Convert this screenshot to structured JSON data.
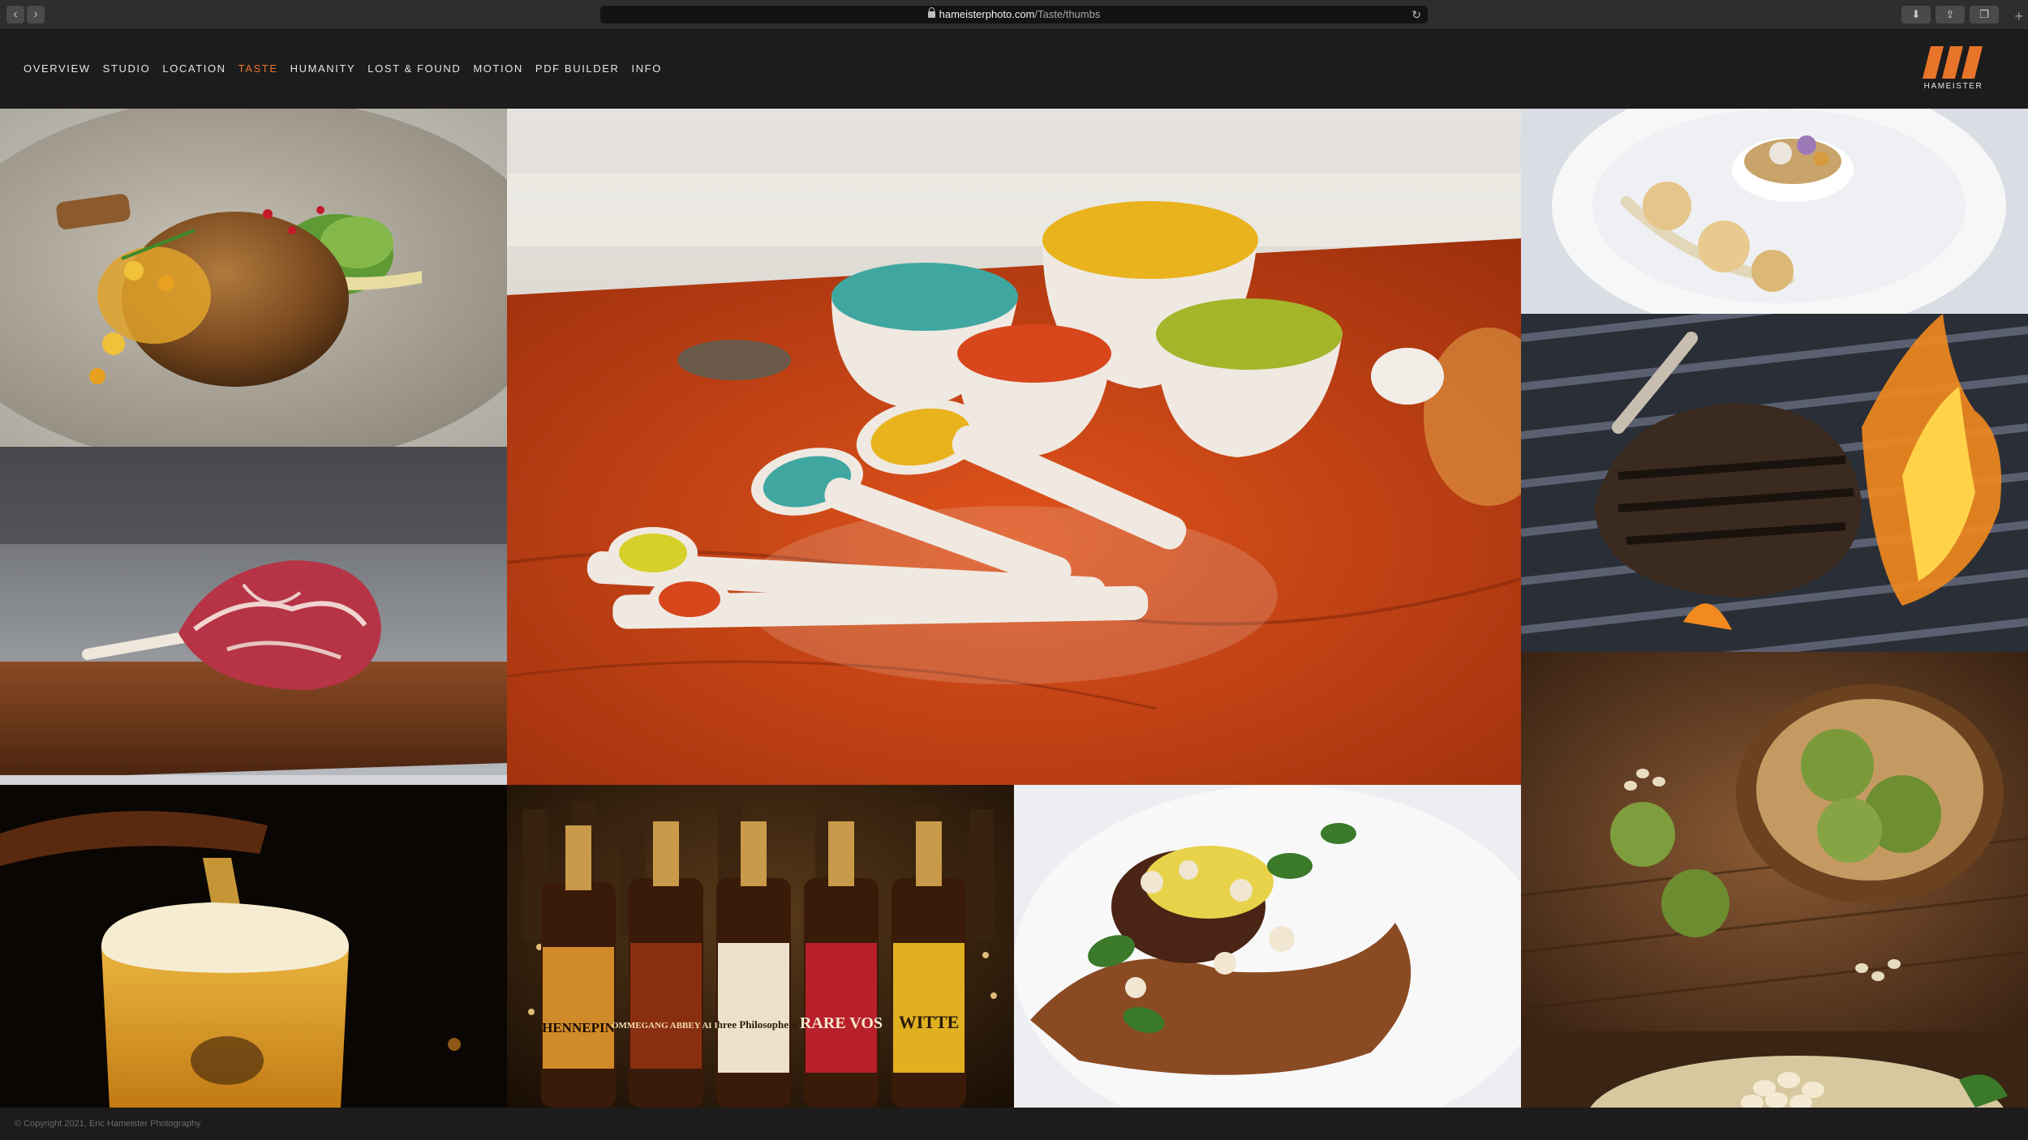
{
  "browser": {
    "url_host": "hameisterphoto.com",
    "url_path": "/Taste/thumbs"
  },
  "nav": {
    "items": [
      {
        "label": "OVERVIEW"
      },
      {
        "label": "STUDIO"
      },
      {
        "label": "LOCATION"
      },
      {
        "label": "TASTE"
      },
      {
        "label": "HUMANITY"
      },
      {
        "label": "LOST & FOUND"
      },
      {
        "label": "MOTION"
      },
      {
        "label": "PDF BUILDER"
      },
      {
        "label": "INFO"
      }
    ],
    "active": "TASTE"
  },
  "logo": {
    "wordmark": "HAMEISTER"
  },
  "colors": {
    "accent": "#e8742a",
    "background": "#1c1c1c"
  },
  "thumbnails": {
    "pork_chop": "pork-chop-photo",
    "measuring_cups": "measuring-cups-photo",
    "dessert": "dessert-plate-photo",
    "raw_steak": "raw-tomahawk-steak-photo",
    "grilled_steak": "grilled-steak-photo",
    "artichokes": "artichoke-bowl-photo",
    "beer_pour": "beer-pour-photo",
    "beer_bottles": "beer-bottles-photo",
    "plated_filet": "plated-filet-photo",
    "dish_bottom_right": "partial-dish-photo"
  },
  "beer_labels": [
    "HENNEPIN",
    "OMMEGANG ABBEY ALE",
    "Three Philosophers",
    "RARE VOS",
    "WITTE"
  ],
  "footer": {
    "copyright": "© Copyright 2021, Eric Hameister Photography"
  }
}
